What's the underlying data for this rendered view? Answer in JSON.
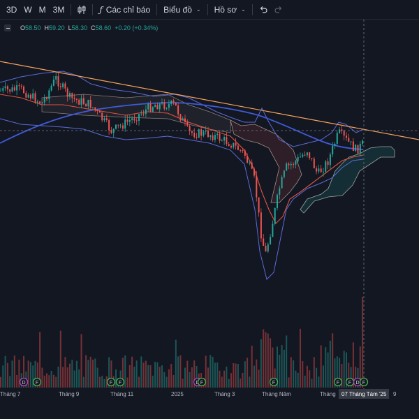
{
  "toolbar": {
    "intervals": [
      "3D",
      "W",
      "M",
      "3M"
    ],
    "indicators_label": "Các chỉ báo",
    "chart_type_label": "Biểu đồ",
    "profile_label": "Hồ sơ"
  },
  "legend": {
    "open_label": "O",
    "open_value": "58.50",
    "high_label": "H",
    "high_value": "59.20",
    "low_label": "L",
    "low_value": "58.30",
    "close_label": "C",
    "close_value": "58.60",
    "change_value": "+0.20 (+0.34%)"
  },
  "xaxis": {
    "labels": [
      "Tháng 7",
      "Tháng 9",
      "Tháng 11",
      "2025",
      "Tháng 3",
      "Tháng Năm",
      "Tháng",
      "9"
    ]
  },
  "crosshair_date": "07 Tháng Tám '25",
  "event_markers": [
    {
      "letter": "D",
      "kind": "dividend"
    },
    {
      "letter": "F",
      "kind": "financial"
    },
    {
      "letter": "F",
      "kind": "financial"
    },
    {
      "letter": "F",
      "kind": "financial"
    },
    {
      "letter": "D",
      "kind": "dividend"
    },
    {
      "letter": "F",
      "kind": "financial"
    },
    {
      "letter": "F",
      "kind": "financial"
    },
    {
      "letter": "F",
      "kind": "financial"
    },
    {
      "letter": "F",
      "kind": "financial"
    },
    {
      "letter": "D",
      "kind": "dividend"
    },
    {
      "letter": "F",
      "kind": "financial"
    }
  ],
  "colors": {
    "background": "#131722",
    "up": "#26a69a",
    "down": "#ef5350",
    "trendline": "#f7a35c",
    "ma_long": "#3f5bd8",
    "bollinger": "#5b6bd6",
    "ma_short": "#e0533f",
    "dividend_marker": "#ab47bc",
    "financial_marker": "#4caf50"
  }
}
